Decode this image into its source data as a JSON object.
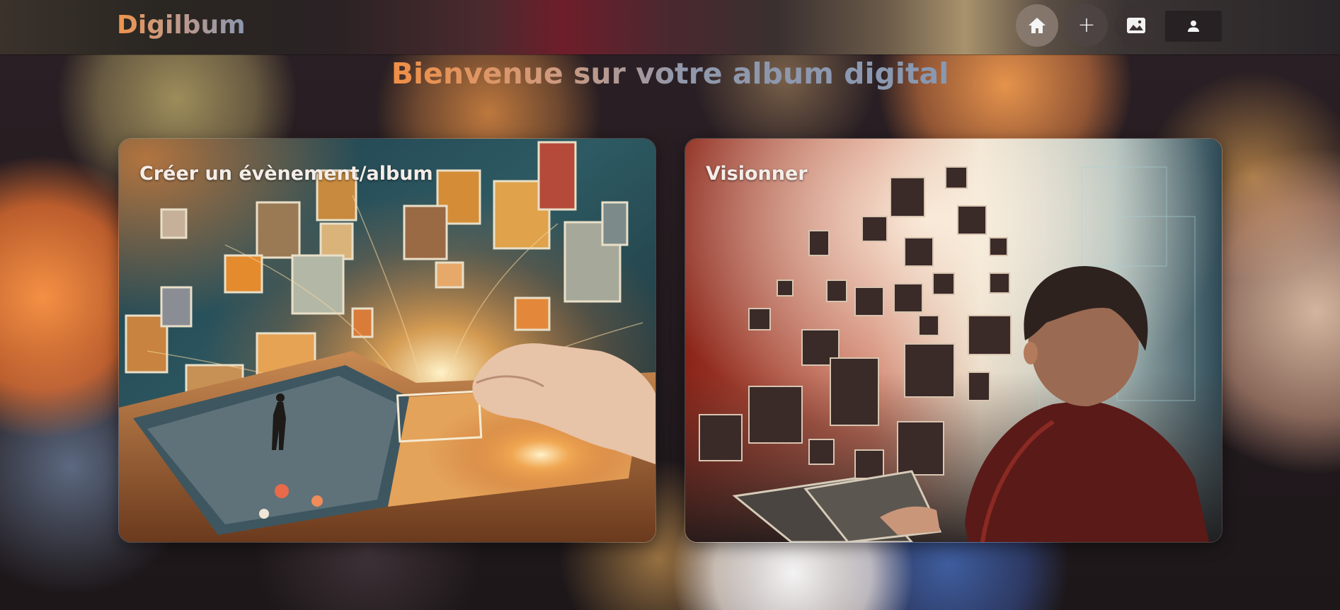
{
  "brand": {
    "name": "Digilbum"
  },
  "nav": {
    "home_icon": "home-icon",
    "add_label": "+",
    "gallery_icon": "image-icon",
    "account_icon": "user-icon"
  },
  "main": {
    "title": "Bienvenue sur votre album digital",
    "cards": [
      {
        "label": "Créer un évènement/album",
        "image": "open-book-with-floating-photos"
      },
      {
        "label": "Visionner",
        "image": "boy-viewing-floating-photos"
      }
    ]
  },
  "colors": {
    "brand_gradient_start": "#f0934a",
    "brand_gradient_end": "#8b97ad",
    "card_text": "#f4ede8"
  }
}
